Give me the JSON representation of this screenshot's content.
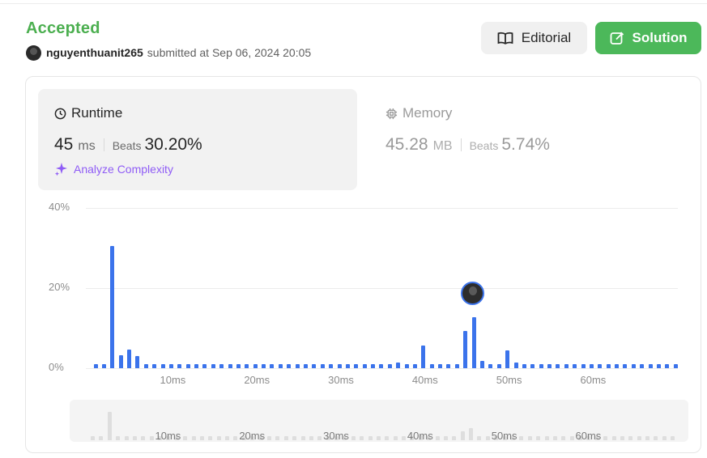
{
  "header": {
    "status": "Accepted",
    "username": "nguyenthuanit265",
    "submitted_text": "submitted at Sep 06, 2024 20:05"
  },
  "buttons": {
    "editorial": "Editorial",
    "solution": "Solution"
  },
  "runtime": {
    "label": "Runtime",
    "value": "45",
    "unit": "ms",
    "beats_label": "Beats",
    "beats_value": "30.20%",
    "analyze": "Analyze Complexity"
  },
  "memory": {
    "label": "Memory",
    "value": "45.28",
    "unit": "MB",
    "beats_label": "Beats",
    "beats_value": "5.74%"
  },
  "colors": {
    "accepted": "#4caf50",
    "solution_button": "#4cb85a",
    "bar": "#3b73eb",
    "analyze": "#8f5cf6"
  },
  "icons": [
    "book-icon",
    "edit-icon",
    "clock-icon",
    "chip-icon",
    "sparkle-icon",
    "avatar-icon"
  ],
  "chart_data": {
    "type": "bar",
    "ylim": [
      0,
      40
    ],
    "ytick_labels": [
      "40%",
      "20%",
      "0%"
    ],
    "xtick_labels": [
      "10ms",
      "20ms",
      "30ms",
      "40ms",
      "50ms",
      "60ms"
    ],
    "x": [
      1,
      2,
      3,
      4,
      5,
      6,
      7,
      8,
      9,
      10,
      11,
      12,
      13,
      14,
      15,
      16,
      17,
      18,
      19,
      20,
      21,
      22,
      23,
      24,
      25,
      26,
      27,
      28,
      29,
      30,
      31,
      32,
      33,
      34,
      35,
      36,
      37,
      38,
      39,
      40,
      41,
      42,
      43,
      44,
      45,
      46,
      47,
      48,
      49,
      50,
      51,
      52,
      53,
      54,
      55,
      56,
      57,
      58,
      59,
      60,
      61,
      62,
      63,
      64,
      65,
      66,
      67,
      68,
      69,
      70
    ],
    "values": [
      1.0,
      1.0,
      30.5,
      3.3,
      4.6,
      3.0,
      1.0,
      1.0,
      1.0,
      1.0,
      1.0,
      1.0,
      1.0,
      1.0,
      1.0,
      1.0,
      1.0,
      1.0,
      1.0,
      1.0,
      1.0,
      1.0,
      1.0,
      1.0,
      1.0,
      1.0,
      1.0,
      1.0,
      1.0,
      1.0,
      1.0,
      1.0,
      1.0,
      1.0,
      1.0,
      1.0,
      1.4,
      1.0,
      1.0,
      5.7,
      1.0,
      1.0,
      1.0,
      1.0,
      9.3,
      12.8,
      1.8,
      1.0,
      1.0,
      4.4,
      1.4,
      1.0,
      1.0,
      1.0,
      1.0,
      1.0,
      1.0,
      1.0,
      1.0,
      1.0,
      1.0,
      1.0,
      1.0,
      1.0,
      1.0,
      1.0,
      1.0,
      1.0,
      1.0,
      1.0
    ],
    "highlight_x": 46
  }
}
